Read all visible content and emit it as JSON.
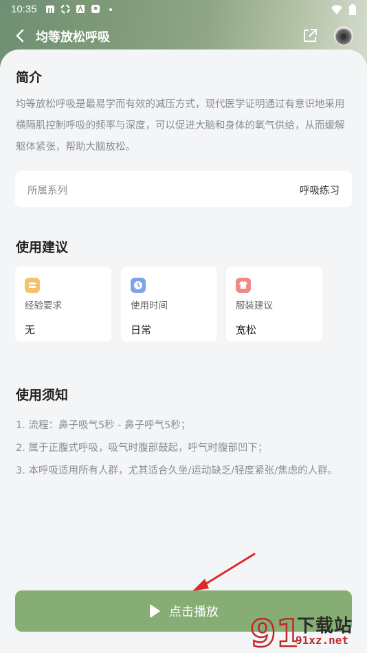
{
  "status_bar": {
    "time": "10:35"
  },
  "header": {
    "title": "均等放松呼吸"
  },
  "intro": {
    "heading": "简介",
    "text": "均等放松呼吸是最易学而有效的减压方式，现代医学证明通过有意识地采用横隔肌控制呼吸的频率与深度，可以促进大脑和身体的氧气供给，从而缓解躯体紧张，帮助大脑放松。",
    "series_label": "所属系列",
    "series_value": "呼吸练习"
  },
  "suggestions": {
    "heading": "使用建议",
    "cards": [
      {
        "icon": "experience-icon",
        "label": "经验要求",
        "value": "无",
        "color": "#f5c26b"
      },
      {
        "icon": "clock-icon",
        "label": "使用时间",
        "value": "日常",
        "color": "#7fa2e8"
      },
      {
        "icon": "shirt-icon",
        "label": "服装建议",
        "value": "宽松",
        "color": "#ee8a87"
      }
    ]
  },
  "notes": {
    "heading": "使用须知",
    "items": [
      "1. 流程：鼻子吸气5秒 - 鼻子呼气5秒；",
      "2. 属于正腹式呼吸，吸气时腹部鼓起，呼气时腹部凹下；",
      "3. 本呼吸适用所有人群，尤其适合久坐/运动缺乏/轻度紧张/焦虑的人群。"
    ]
  },
  "play_button": {
    "label": "点击播放"
  },
  "watermark": {
    "main": "下载站",
    "sub": "91xz.net",
    "num": "91"
  },
  "colors": {
    "accent": "#86ad74",
    "annotation_arrow": "#e0282b"
  }
}
